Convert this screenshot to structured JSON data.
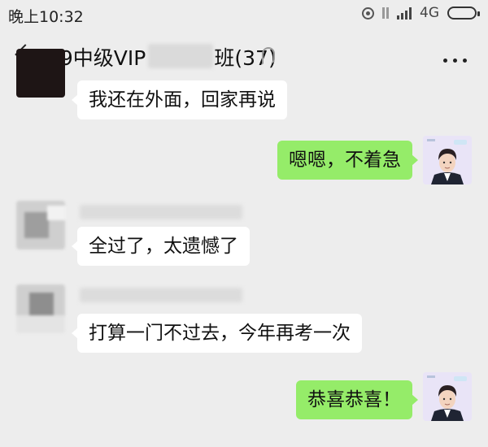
{
  "status_bar": {
    "time": "晚上10:32",
    "network": "4G"
  },
  "header": {
    "title_prefix": "19中级VIP",
    "title_suffix": "班(37)"
  },
  "messages": [
    {
      "side": "left",
      "text": "我还在外面，回家再说"
    },
    {
      "side": "right",
      "text": "嗯嗯，不着急"
    },
    {
      "side": "left",
      "text": "全过了，太遗憾了"
    },
    {
      "side": "left",
      "text": "打算一门不过去，今年再考一次"
    },
    {
      "side": "right",
      "text": "恭喜恭喜！"
    }
  ],
  "colors": {
    "background": "#ededed",
    "incoming_bubble": "#ffffff",
    "outgoing_bubble": "#95ec69"
  },
  "icons": {
    "back": "back-arrow-icon",
    "ear": "ear-mode-icon",
    "more": "more-icon",
    "location": "location-icon",
    "signal": "signal-icon",
    "battery": "battery-icon"
  }
}
